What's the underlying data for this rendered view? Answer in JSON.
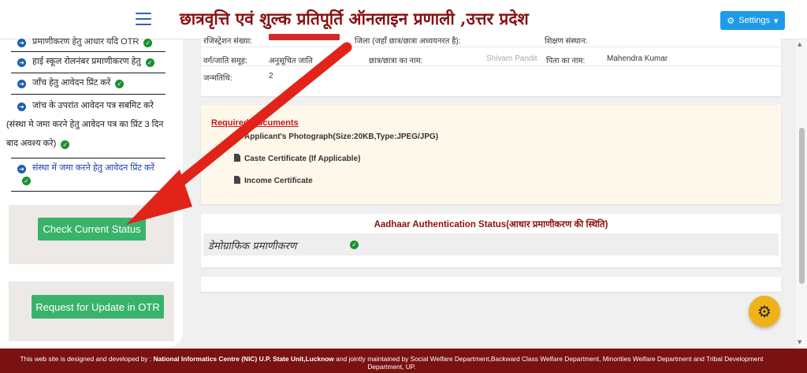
{
  "header": {
    "title": "छात्रवृत्ति एवं शुल्क प्रतिपूर्ति ऑनलाइन प्रणाली ,उत्तर प्रदेश",
    "settings_label": "Settings",
    "menu_icon": "hamburger-icon",
    "settings_icon": "gear-icon"
  },
  "sidebar": {
    "items": [
      {
        "label": "प्रमाणीकरण हेतु आधार यदि OTR",
        "status": "check"
      },
      {
        "label": "हाई स्कूल रोलनंबर प्रमाणीकरण हेतु",
        "status": "check"
      },
      {
        "label": "जाँच हेतु आवेदन प्रिंट करें",
        "status": "check"
      },
      {
        "label_line1": "जांच के उपरांत आवेदन पत्र सबमिट करे",
        "label_line2": "(संस्था मे जमा करने हेतु आवेदन पत्र का प्रिंट 3 दिन",
        "label_line3": "बाद अवश्य करे)",
        "status": "check"
      },
      {
        "label": "संस्था में जमा करने हेतु आवेदन प्रिंट करें",
        "status": "check"
      }
    ],
    "check_status_button": "Check Current Status",
    "update_otr_button": "Request for Update in OTR"
  },
  "info": {
    "row1": {
      "label_a": "रजिस्ट्रेशन संख्या:",
      "label_b": "जिला (जहाँ छात्र/छात्रा अध्ययनरत है):",
      "label_c": "शिक्षण संस्थान:"
    },
    "row2": {
      "label_a": "वर्ग/जाति समूह:",
      "value_a": "अनुसूचित जाति",
      "label_b": "छात्र/छात्रा का नाम:",
      "value_b": "Shivam Pandit",
      "label_c": "पिता का नाम:",
      "value_c": "Mahendra Kumar"
    },
    "row3": {
      "label_a": "जन्मतिथि:",
      "value_a": "2"
    }
  },
  "documents": {
    "title": "Required Documents",
    "items": [
      "Applicant's Photograph(Size:20KB,Type:JPEG/JPG)",
      "Caste Certificate (If Applicable)",
      "Income Certificate"
    ]
  },
  "aadhaar": {
    "title": "Aadhaar Authentication Status(आधार प्रमाणीकरण की स्थिति)",
    "row_label": "डेमोग्राफिक प्रमाणीकरण",
    "status": "check"
  },
  "footer": {
    "prefix": "This web site is designed and developed by : ",
    "bold": "National Informatics Centre (NIC) U.P. State Unit,Lucknow",
    "suffix": " and jointly maintained by Social Welfare Department,Backward Class Welfare Department, Minorities Welfare Department and Tribal Development Department, UP."
  },
  "colors": {
    "accent_blue": "#1e9be8",
    "title_red": "#8b0f0f",
    "button_green": "#39b36b",
    "footer_bg": "#7a1212",
    "fab_yellow": "#f0b21a",
    "arrow_red": "#e2231a"
  }
}
